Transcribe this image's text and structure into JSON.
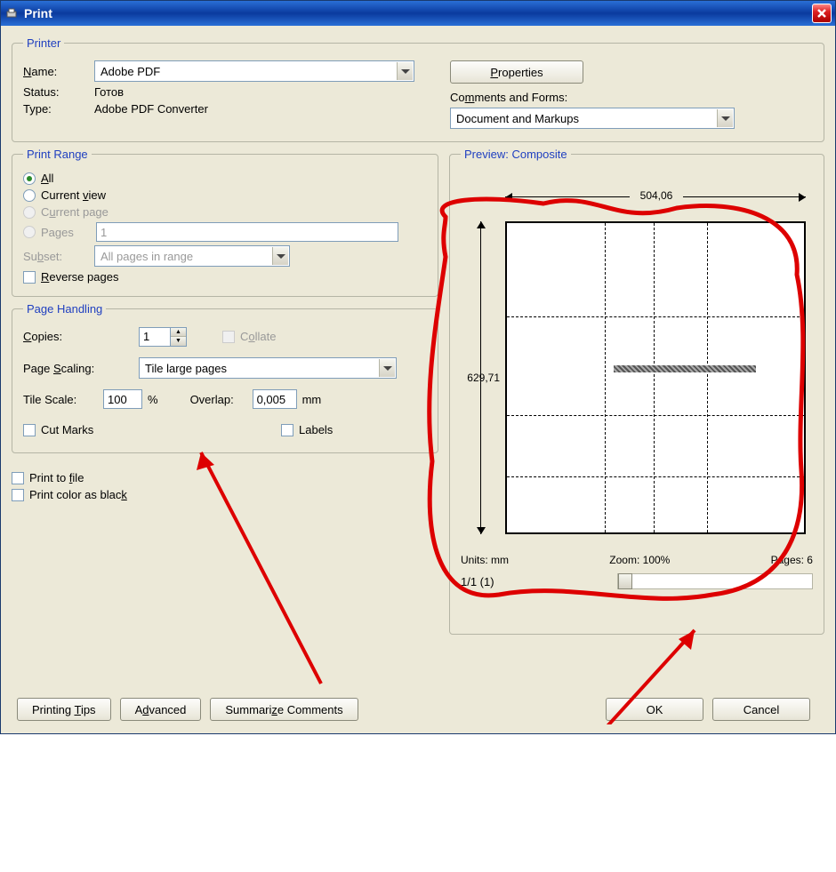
{
  "window": {
    "title": "Print"
  },
  "printer": {
    "legend": "Printer",
    "name_label": "Name:",
    "name_value": "Adobe PDF",
    "status_label": "Status:",
    "status_value": "Готов",
    "type_label": "Type:",
    "type_value": "Adobe PDF Converter",
    "properties_btn": "Properties",
    "comments_label": "Comments and Forms:",
    "comments_value": "Document and Markups"
  },
  "range": {
    "legend": "Print Range",
    "all": "All",
    "current_view": "Current view",
    "current_page": "Current page",
    "pages": "Pages",
    "pages_value": "1",
    "subset_label": "Subset:",
    "subset_value": "All pages in range",
    "reverse": "Reverse pages"
  },
  "handling": {
    "legend": "Page Handling",
    "copies_label": "Copies:",
    "copies_value": "1",
    "collate": "Collate",
    "scaling_label": "Page Scaling:",
    "scaling_value": "Tile large pages",
    "tilescale_label": "Tile Scale:",
    "tilescale_value": "100",
    "tilescale_unit": "%",
    "overlap_label": "Overlap:",
    "overlap_value": "0,005",
    "overlap_unit": "mm",
    "cutmarks": "Cut Marks",
    "labels": "Labels"
  },
  "misc": {
    "print_to_file": "Print to file",
    "print_color_black": "Print color as black"
  },
  "preview": {
    "legend": "Preview: Composite",
    "width": "504,06",
    "height": "629,71",
    "units_label": "Units:",
    "units_value": "mm",
    "zoom_label": "Zoom:",
    "zoom_value": "100%",
    "pages_label": "Pages:",
    "pages_value": "6",
    "page_indicator": "1/1 (1)"
  },
  "buttons": {
    "tips": "Printing Tips",
    "advanced": "Advanced",
    "summarize": "Summarize Comments",
    "ok": "OK",
    "cancel": "Cancel"
  }
}
